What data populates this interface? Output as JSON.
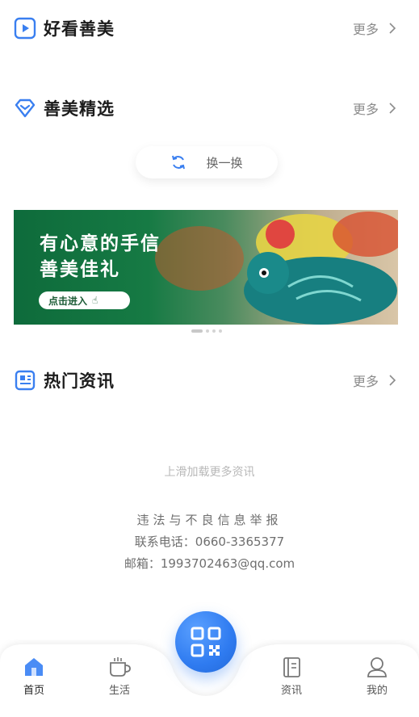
{
  "sections": {
    "featured": {
      "title": "好看善美",
      "more": "更多"
    },
    "selection": {
      "title": "善美精选",
      "more": "更多"
    },
    "news": {
      "title": "热门资讯",
      "more": "更多"
    }
  },
  "refresh": {
    "label": "换一换"
  },
  "banner": {
    "line1": "有心意的手信",
    "line2": "善美佳礼",
    "cta": "点击进入"
  },
  "news_list": {
    "load_more": "上滑加载更多资讯"
  },
  "footer": {
    "report": "违法与不良信息举报",
    "phone": "联系电话：0660-3365377",
    "email": "邮箱：1993702463@qq.com"
  },
  "tabbar": {
    "home": "首页",
    "life": "生活",
    "news": "资讯",
    "mine": "我的"
  },
  "colors": {
    "accent": "#2f7bf0",
    "banner_green": "#0e6b3b"
  }
}
